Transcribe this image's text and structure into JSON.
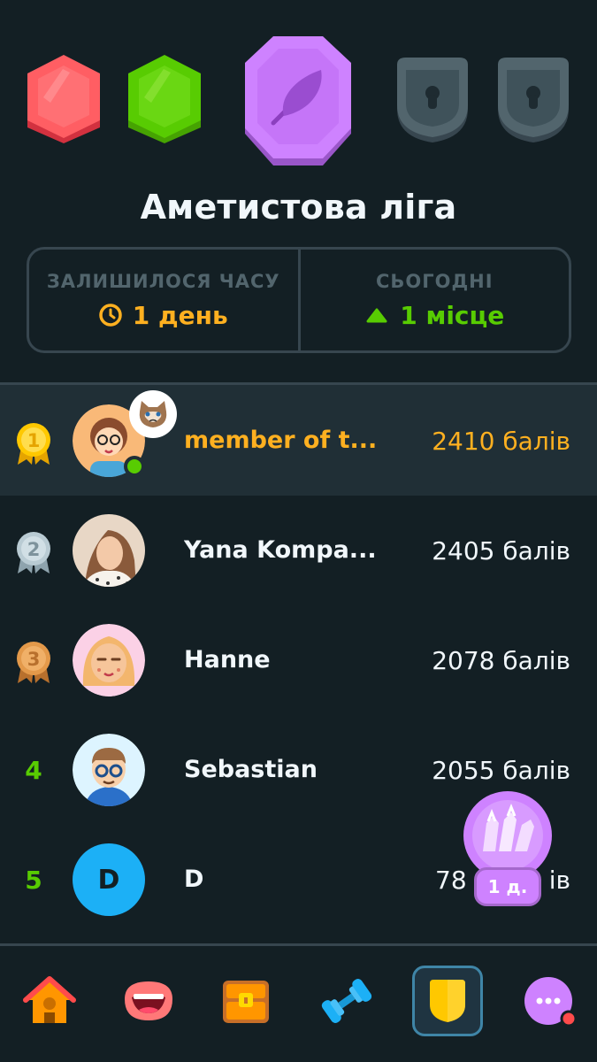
{
  "league": {
    "title": "Аметистова ліга",
    "badges": [
      "ruby",
      "emerald",
      "amethyst",
      "locked",
      "locked"
    ]
  },
  "stats": {
    "time_left_label": "ЗАЛИШИЛОСЯ ЧАСУ",
    "time_left_value": "1 день",
    "today_label": "СЬОГОДНІ",
    "today_value": "1 місце"
  },
  "leaderboard": [
    {
      "rank": "1",
      "name": "member of t...",
      "score": "2410 балів",
      "is_me": true
    },
    {
      "rank": "2",
      "name": "Yana Kompa...",
      "score": "2405 балів"
    },
    {
      "rank": "3",
      "name": "Hanne",
      "score": "2078 балів"
    },
    {
      "rank": "4",
      "name": "Sebastian",
      "score": "2055 балів"
    },
    {
      "rank": "5",
      "name": "D",
      "avatar_letter": "D",
      "score": "78",
      "score_suffix": "ів"
    }
  ],
  "streak_bubble": {
    "label": "1 д."
  },
  "nav": [
    "home-icon",
    "speak-icon",
    "chest-icon",
    "dumbbell-icon",
    "shield-icon",
    "more-icon"
  ],
  "colors": {
    "background": "#131f24",
    "highlight_row": "#202f36",
    "orange": "#ffb020",
    "green": "#58cc02",
    "purple": "#ce82ff",
    "border": "#37464f"
  }
}
